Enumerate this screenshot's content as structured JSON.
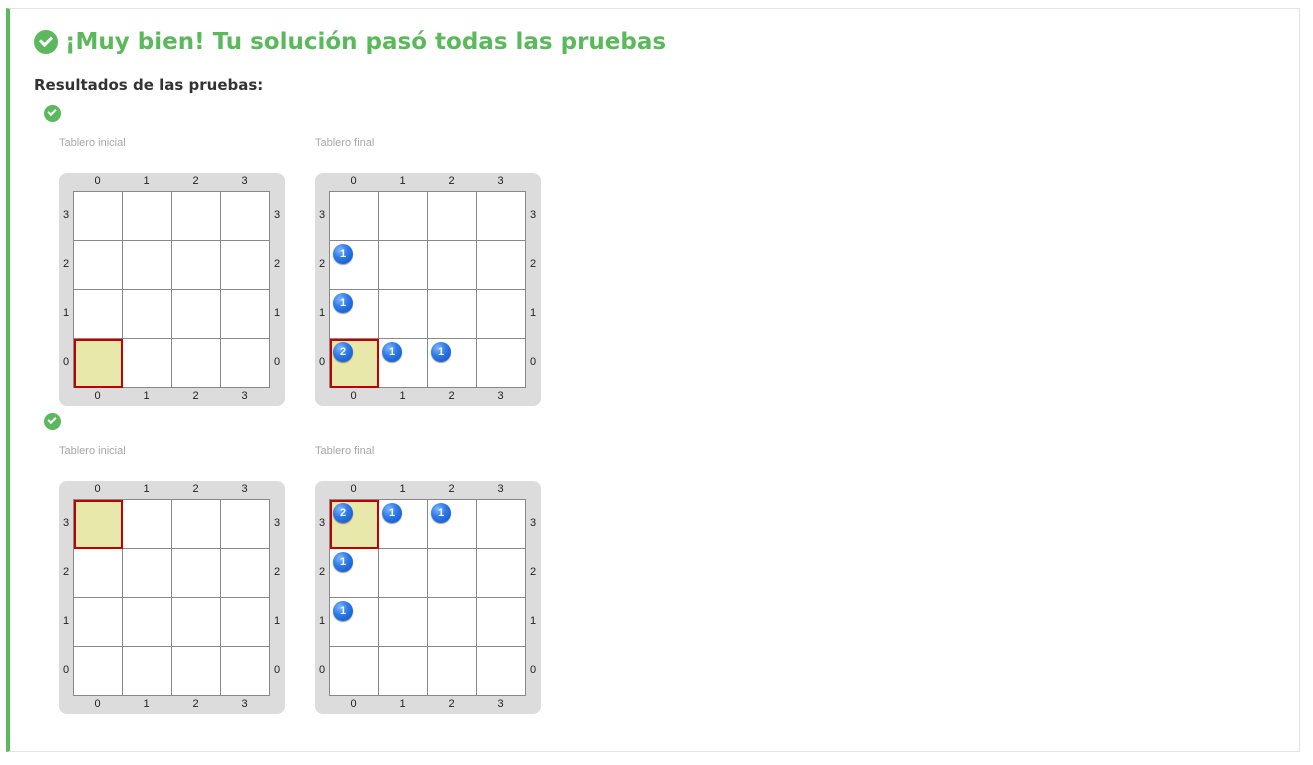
{
  "result": {
    "title": "¡Muy bien! Tu solución pasó todas las pruebas",
    "subtitle": "Resultados de las pruebas:"
  },
  "colors": {
    "success": "#5cb85c",
    "head_fill": "#e8e8ab",
    "head_border": "#c00000",
    "stone_blue": "#2f7ce8",
    "board_bg": "#dcdcdc"
  },
  "icons": {
    "success": "check-circle-icon",
    "stone": "blue-stone-icon"
  },
  "tests": [
    {
      "initial": {
        "label": "Tablero inicial",
        "columns": [
          "0",
          "1",
          "2",
          "3"
        ],
        "rows": [
          "3",
          "2",
          "1",
          "0"
        ],
        "head": {
          "x": 0,
          "y": 0
        },
        "stones": []
      },
      "final": {
        "label": "Tablero final",
        "columns": [
          "0",
          "1",
          "2",
          "3"
        ],
        "rows": [
          "3",
          "2",
          "1",
          "0"
        ],
        "head": {
          "x": 0,
          "y": 0
        },
        "stones": [
          {
            "x": 0,
            "y": 2,
            "count": "1"
          },
          {
            "x": 0,
            "y": 1,
            "count": "1"
          },
          {
            "x": 0,
            "y": 0,
            "count": "2"
          },
          {
            "x": 1,
            "y": 0,
            "count": "1"
          },
          {
            "x": 2,
            "y": 0,
            "count": "1"
          }
        ]
      }
    },
    {
      "initial": {
        "label": "Tablero inicial",
        "columns": [
          "0",
          "1",
          "2",
          "3"
        ],
        "rows": [
          "3",
          "2",
          "1",
          "0"
        ],
        "head": {
          "x": 0,
          "y": 3
        },
        "stones": []
      },
      "final": {
        "label": "Tablero final",
        "columns": [
          "0",
          "1",
          "2",
          "3"
        ],
        "rows": [
          "3",
          "2",
          "1",
          "0"
        ],
        "head": {
          "x": 0,
          "y": 3
        },
        "stones": [
          {
            "x": 0,
            "y": 3,
            "count": "2"
          },
          {
            "x": 1,
            "y": 3,
            "count": "1"
          },
          {
            "x": 2,
            "y": 3,
            "count": "1"
          },
          {
            "x": 0,
            "y": 2,
            "count": "1"
          },
          {
            "x": 0,
            "y": 1,
            "count": "1"
          }
        ]
      }
    }
  ]
}
